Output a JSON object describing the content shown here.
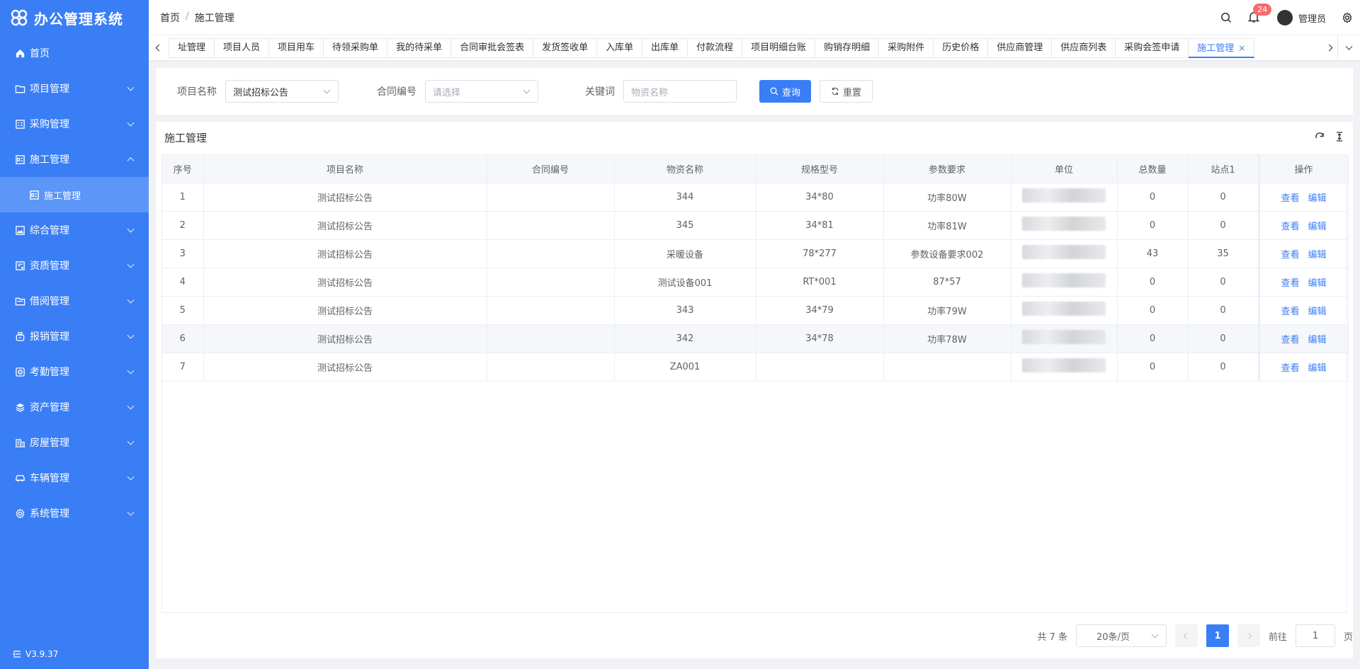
{
  "app": {
    "title": "办公管理系统",
    "version": "V3.9.37"
  },
  "sidebar": {
    "items": [
      {
        "label": "首页",
        "icon": "home-icon",
        "expandable": false
      },
      {
        "label": "项目管理",
        "icon": "folder-icon",
        "expandable": true
      },
      {
        "label": "采购管理",
        "icon": "list-icon",
        "expandable": true
      },
      {
        "label": "施工管理",
        "icon": "construction-icon",
        "expandable": true,
        "expanded": true
      },
      {
        "label": "综合管理",
        "icon": "image-icon",
        "expandable": true
      },
      {
        "label": "资质管理",
        "icon": "certificate-icon",
        "expandable": true
      },
      {
        "label": "借阅管理",
        "icon": "folder-open-icon",
        "expandable": true
      },
      {
        "label": "报销管理",
        "icon": "money-bag-icon",
        "expandable": true
      },
      {
        "label": "考勤管理",
        "icon": "attendance-icon",
        "expandable": true
      },
      {
        "label": "资产管理",
        "icon": "layers-icon",
        "expandable": true
      },
      {
        "label": "房屋管理",
        "icon": "building-icon",
        "expandable": true
      },
      {
        "label": "车辆管理",
        "icon": "car-icon",
        "expandable": true
      },
      {
        "label": "系统管理",
        "icon": "gear-icon",
        "expandable": true
      }
    ],
    "submenu": {
      "label": "施工管理"
    }
  },
  "header": {
    "breadcrumb": [
      "首页",
      "施工管理"
    ],
    "notifications": "24",
    "user": "管理员"
  },
  "tabs": [
    "址管理",
    "项目人员",
    "项目用车",
    "待领采购单",
    "我的待采单",
    "合同审批会签表",
    "发货签收单",
    "入库单",
    "出库单",
    "付款流程",
    "项目明细台账",
    "购销存明细",
    "采购附件",
    "历史价格",
    "供应商管理",
    "供应商列表",
    "采购会签申请",
    "施工管理"
  ],
  "active_tab_close": "×",
  "filter": {
    "project_label": "项目名称",
    "project_value": "测试招标公告",
    "contract_label": "合同编号",
    "contract_placeholder": "请选择",
    "keyword_label": "关键词",
    "keyword_placeholder": "物资名称",
    "search_button": "查询",
    "reset_button": "重置"
  },
  "card": {
    "title": "施工管理"
  },
  "table": {
    "headers": [
      "序号",
      "项目名称",
      "合同编号",
      "物资名称",
      "规格型号",
      "参数要求",
      "单位",
      "总数量",
      "站点1",
      "操作"
    ],
    "rows": [
      [
        "1",
        "测试招标公告",
        "",
        "344",
        "34*80",
        "功率80W",
        "",
        "0",
        "0"
      ],
      [
        "2",
        "测试招标公告",
        "",
        "345",
        "34*81",
        "功率81W",
        "",
        "0",
        "0"
      ],
      [
        "3",
        "测试招标公告",
        "",
        "采暖设备",
        "78*277",
        "参数设备要求002",
        "",
        "43",
        "35"
      ],
      [
        "4",
        "测试招标公告",
        "",
        "测试设备001",
        "RT*001",
        "87*57",
        "",
        "0",
        "0"
      ],
      [
        "5",
        "测试招标公告",
        "",
        "343",
        "34*79",
        "功率79W",
        "",
        "0",
        "0"
      ],
      [
        "6",
        "测试招标公告",
        "",
        "342",
        "34*78",
        "功率78W",
        "",
        "0",
        "0"
      ],
      [
        "7",
        "测试招标公告",
        "",
        "ZA001",
        "",
        "",
        "",
        "0",
        "0"
      ]
    ],
    "view_label": "查看",
    "edit_label": "编辑"
  },
  "pagination": {
    "total": "共 7 条",
    "page_size": "20条/页",
    "current": "1",
    "goto_label": "前往",
    "goto_value": "1",
    "page_suffix": "页"
  },
  "colors": {
    "primary": "#3a7ef6",
    "sidebar": "#3a7ef6",
    "badge": "#f56c6c"
  }
}
